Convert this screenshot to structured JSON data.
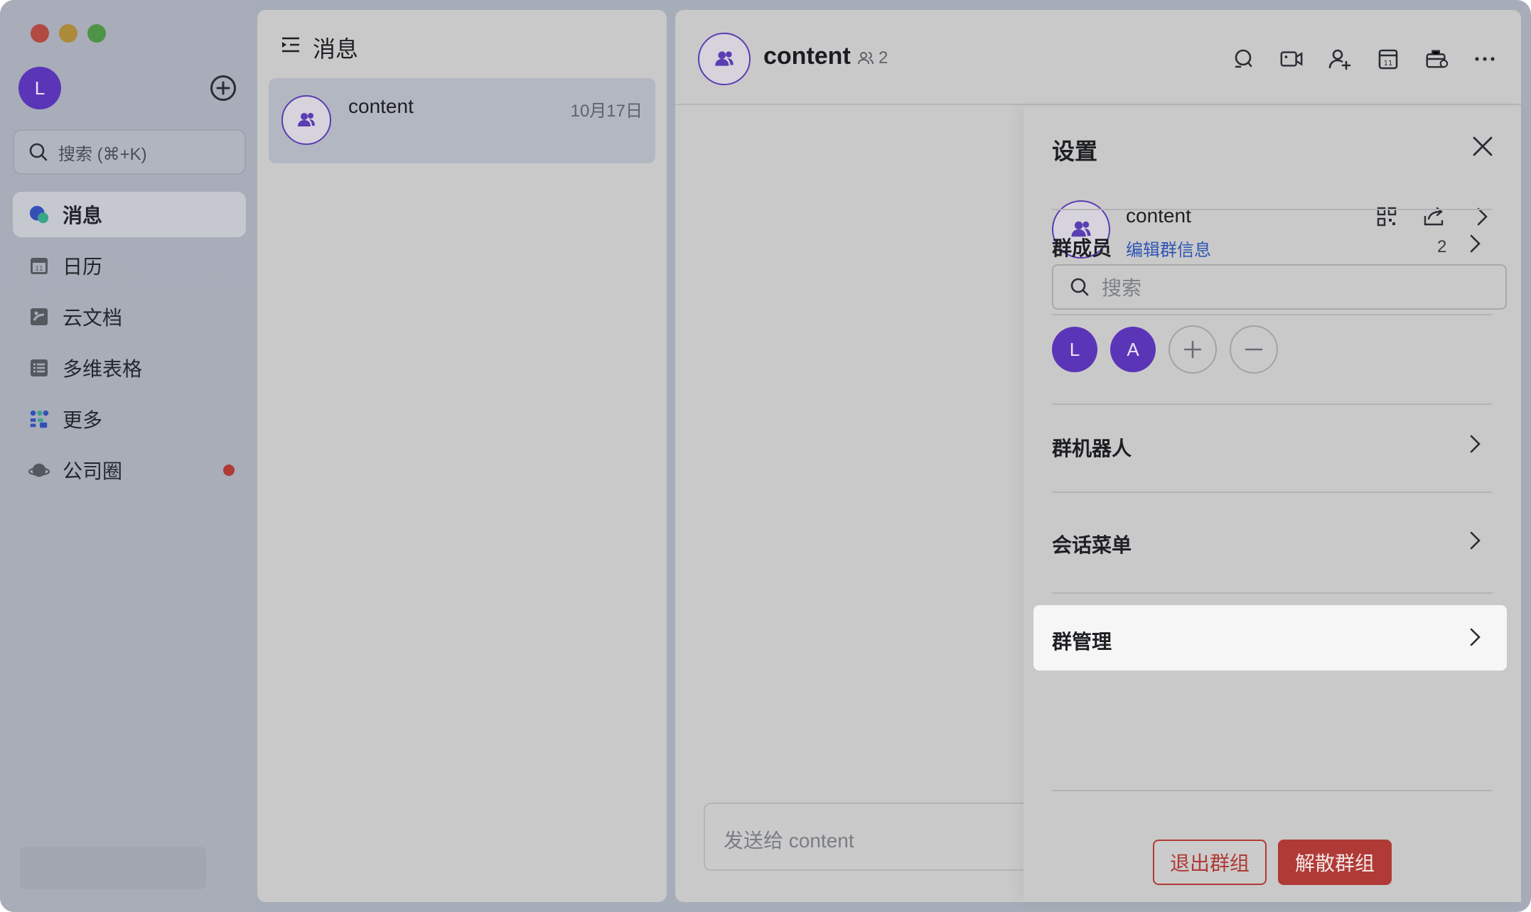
{
  "user": {
    "avatar_initial": "L"
  },
  "sidebar": {
    "search_placeholder": "搜索 (⌘+K)",
    "items": [
      {
        "label": "消息",
        "icon": "chat-bubble-icon",
        "active": true
      },
      {
        "label": "日历",
        "icon": "calendar-icon",
        "active": false
      },
      {
        "label": "云文档",
        "icon": "cloud-doc-icon",
        "active": false
      },
      {
        "label": "多维表格",
        "icon": "table-icon",
        "active": false
      },
      {
        "label": "更多",
        "icon": "apps-grid-icon",
        "active": false
      },
      {
        "label": "公司圈",
        "icon": "planet-icon",
        "active": false,
        "has_notification": true
      }
    ]
  },
  "conversation_list": {
    "title": "消息",
    "items": [
      {
        "name": "content",
        "date": "10月17日"
      }
    ]
  },
  "chat": {
    "title": "content",
    "member_count": "2",
    "input_placeholder": "发送给 content",
    "header_icons": [
      "search-chat-icon",
      "video-icon",
      "add-member-icon",
      "calendar-icon",
      "briefcase-icon",
      "more-icon"
    ]
  },
  "settings": {
    "title": "设置",
    "group_name": "content",
    "edit_link": "编辑群信息",
    "members_label": "群成员",
    "members_count": "2",
    "member_search_placeholder": "搜索",
    "members": [
      "L",
      "A"
    ],
    "bots_label": "群机器人",
    "menu_label": "会话菜单",
    "manage_label": "群管理",
    "quit_button": "退出群组",
    "dismiss_button": "解散群组"
  },
  "colors": {
    "accent_purple": "#5b35b7",
    "link_blue": "#2f55b5",
    "danger_red": "#b03a36"
  }
}
